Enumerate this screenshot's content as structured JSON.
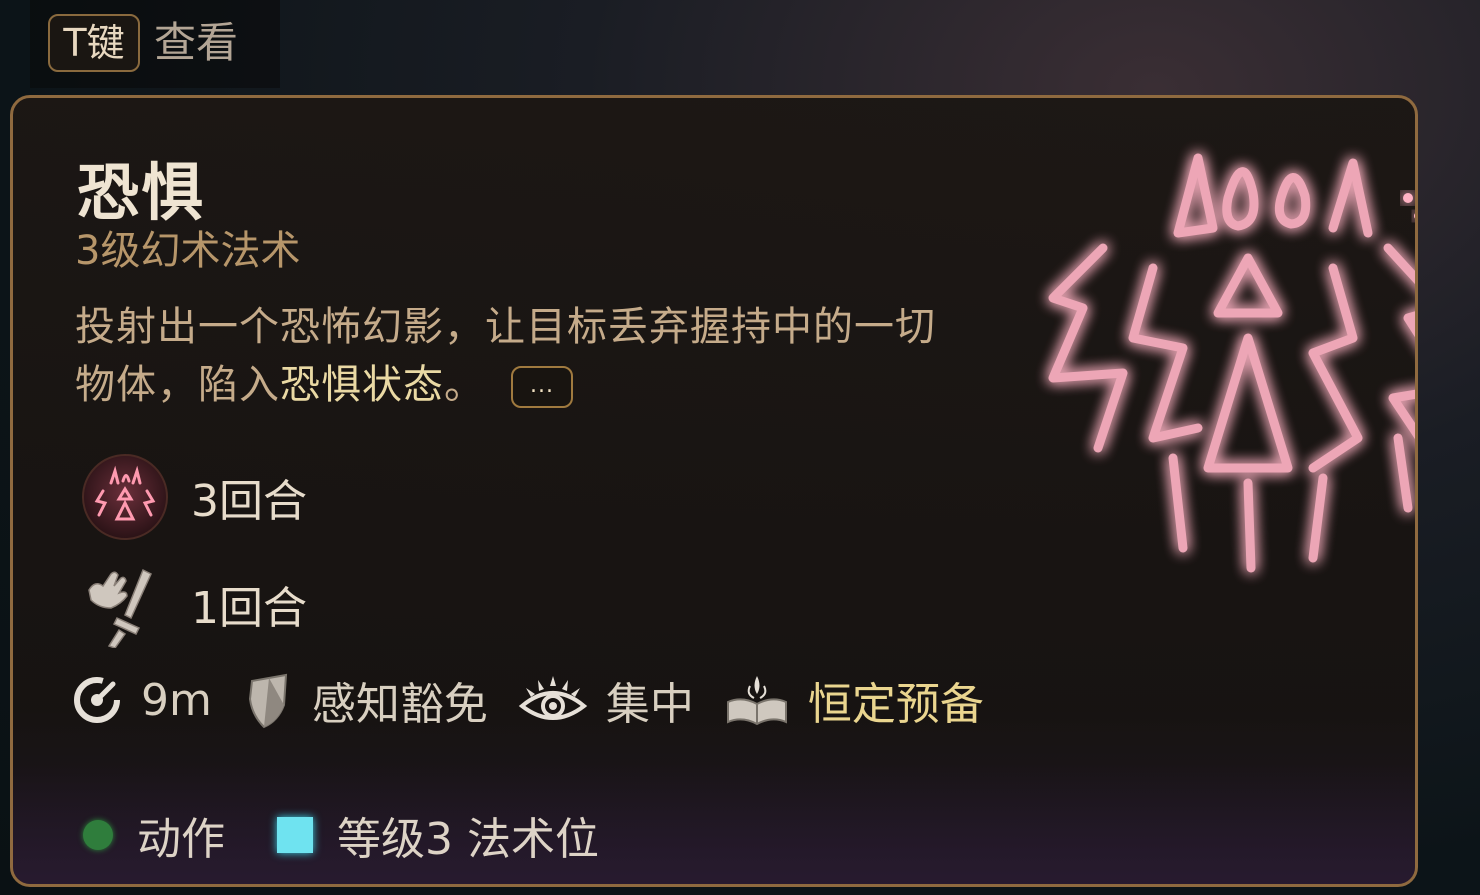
{
  "hint": {
    "key": "T键",
    "label": "查看"
  },
  "spell": {
    "name": "恐惧",
    "subtitle": "3级幻术法术",
    "description_part1": "投射出一个恐怖幻影，让目标丢弃握持中的一切物体，陷入",
    "description_highlight": "恐惧状态",
    "description_part2": "。",
    "more_button": "...",
    "art_icon": "fear-sigil-icon"
  },
  "effects": [
    {
      "icon": "fear-condition-icon",
      "duration": "3回合"
    },
    {
      "icon": "hand-dagger-icon",
      "duration": "1回合"
    }
  ],
  "stats": {
    "range": "9m",
    "save": "感知豁免",
    "concentration": "集中",
    "prepared": "恒定预备"
  },
  "costs": {
    "action": "动作",
    "spell_slot": "等级3 法术位"
  },
  "colors": {
    "border": "#8f6a3f",
    "highlight": "#ead9a4",
    "action_dot": "#2f7d3c",
    "slot_square": "#6fe3f0",
    "sigil_glow": "#ff7a9a"
  }
}
